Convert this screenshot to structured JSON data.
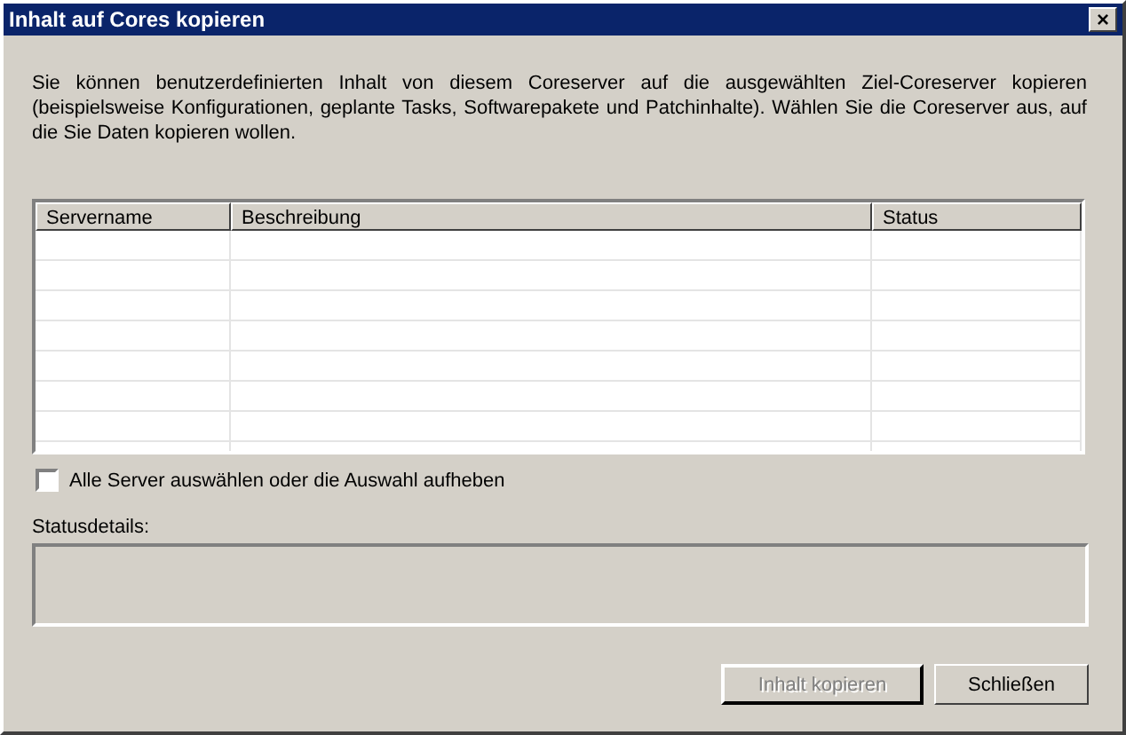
{
  "window": {
    "title": "Inhalt auf Cores kopieren",
    "close": "×"
  },
  "description": "Sie können benutzerdefinierten Inhalt von diesem Coreserver auf die ausgewählten Ziel-Coreserver kopieren (beispielsweise Konfigurationen, geplante Tasks, Softwarepakete und Patchinhalte). Wählen Sie die Coreserver aus, auf die Sie Daten kopieren wollen.",
  "table": {
    "columns": [
      "Servername",
      "Beschreibung",
      "Status"
    ]
  },
  "select_all": {
    "label": "Alle Server auswählen oder die Auswahl aufheben",
    "checked": false
  },
  "status_details": {
    "label": "Statusdetails:"
  },
  "buttons": [
    {
      "label": "Inhalt kopieren",
      "disabled": true,
      "default": true
    },
    {
      "label": "Schließen",
      "disabled": false,
      "default": false
    }
  ]
}
